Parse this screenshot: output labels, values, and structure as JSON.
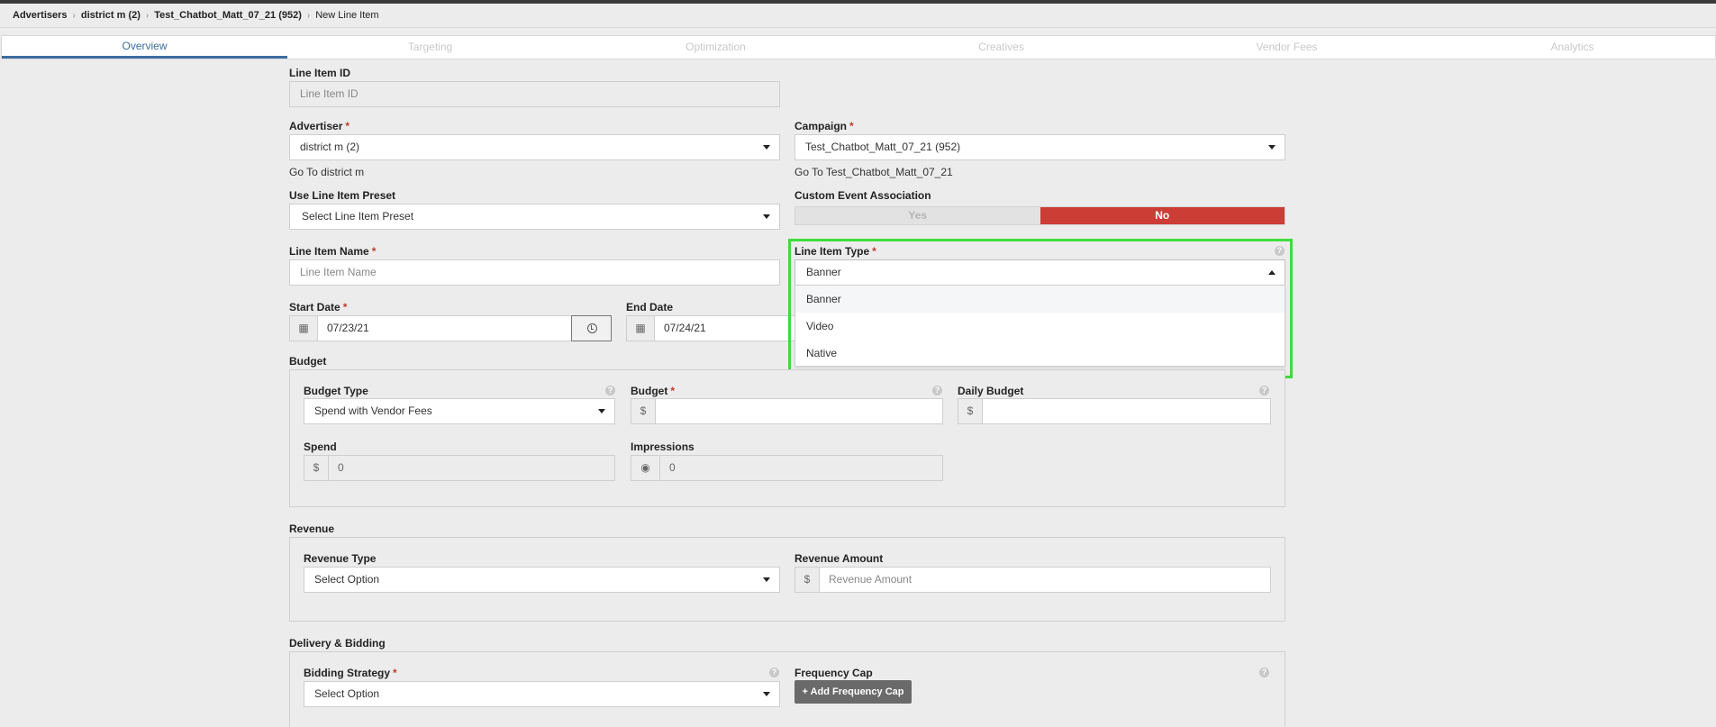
{
  "breadcrumb": {
    "advertisers": "Advertisers",
    "advertiser": "district m (2)",
    "campaign": "Test_Chatbot_Matt_07_21 (952)",
    "current": "New Line Item"
  },
  "tabs": [
    "Overview",
    "Targeting",
    "Optimization",
    "Creatives",
    "Vendor Fees",
    "Analytics"
  ],
  "line_item_id": {
    "label": "Line Item ID",
    "placeholder": "Line Item ID"
  },
  "advertiser": {
    "label": "Advertiser",
    "value": "district m (2)",
    "link": "Go To district m"
  },
  "campaign": {
    "label": "Campaign",
    "value": "Test_Chatbot_Matt_07_21 (952)",
    "link": "Go To Test_Chatbot_Matt_07_21"
  },
  "preset": {
    "label": "Use Line Item Preset",
    "value": "Select Line Item Preset"
  },
  "custom_event": {
    "label": "Custom Event Association",
    "yes": "Yes",
    "no": "No"
  },
  "name": {
    "label": "Line Item Name",
    "placeholder": "Line Item Name"
  },
  "type": {
    "label": "Line Item Type",
    "value": "Banner",
    "options": [
      "Banner",
      "Video",
      "Native"
    ]
  },
  "start_date": {
    "label": "Start Date",
    "value": "07/23/21"
  },
  "end_date": {
    "label": "End Date",
    "value": "07/24/21"
  },
  "budget": {
    "title": "Budget",
    "type_label": "Budget Type",
    "type_value": "Spend with Vendor Fees",
    "budget_label": "Budget",
    "daily_label": "Daily Budget",
    "currency": "$",
    "spend_label": "Spend",
    "spend_value": "0",
    "impressions_label": "Impressions",
    "impressions_value": "0"
  },
  "revenue": {
    "title": "Revenue",
    "type_label": "Revenue Type",
    "type_value": "Select Option",
    "amount_label": "Revenue Amount",
    "amount_placeholder": "Revenue Amount",
    "currency": "$"
  },
  "delivery": {
    "title": "Delivery & Bidding",
    "strategy_label": "Bidding Strategy",
    "strategy_value": "Select Option",
    "freq_label": "Frequency Cap",
    "freq_button": "+ Add Frequency Cap"
  },
  "help_glyph": "?",
  "colors": {
    "accent": "#3d6ea0",
    "danger": "#cc3d36",
    "highlight": "#3ddc3d"
  }
}
